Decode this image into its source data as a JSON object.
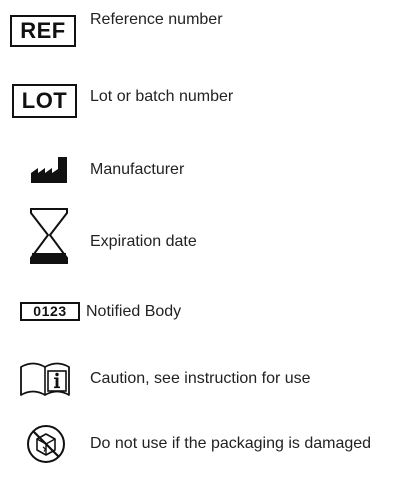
{
  "colors": {
    "ink": "#111111",
    "text": "#222222",
    "background": "#ffffff"
  },
  "symbols": [
    {
      "id": "ref",
      "icon": "ref-boxed-text-icon",
      "symbol_text": "REF",
      "label": "Reference number"
    },
    {
      "id": "lot",
      "icon": "lot-boxed-text-icon",
      "symbol_text": "LOT",
      "label": "Lot or batch number"
    },
    {
      "id": "manufacturer",
      "icon": "factory-icon",
      "label": "Manufacturer"
    },
    {
      "id": "expiration",
      "icon": "hourglass-icon",
      "label": "Expiration date"
    },
    {
      "id": "notified-body",
      "icon": "notified-body-number-icon",
      "symbol_text": "0123",
      "label": "Notified Body"
    },
    {
      "id": "instructions",
      "icon": "book-info-icon",
      "label": "Caution, see instruction for use"
    },
    {
      "id": "damaged-package",
      "icon": "damaged-package-prohibited-icon",
      "label": "Do not use if the packaging is damaged"
    }
  ]
}
